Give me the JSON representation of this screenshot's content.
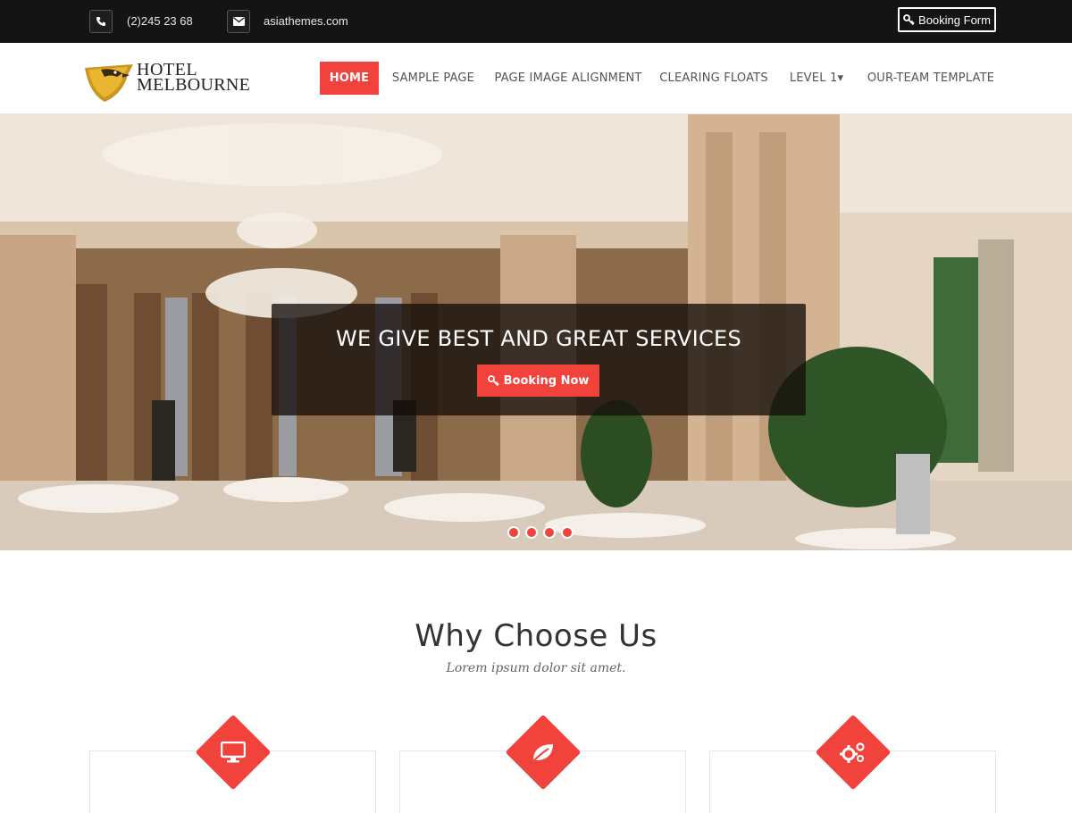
{
  "topbar": {
    "phone": "(2)245 23 68",
    "email": "asiathemes.com",
    "booking_form_label": "Booking Form"
  },
  "brand": {
    "line1": "HOTEL",
    "line2": "MELBOURNE"
  },
  "nav": {
    "items": [
      {
        "label": "HOME",
        "active": true
      },
      {
        "label": "SAMPLE PAGE",
        "active": false
      },
      {
        "label": "PAGE IMAGE ALIGNMENT",
        "active": false
      },
      {
        "label": "CLEARING FLOATS",
        "active": false
      },
      {
        "label": "LEVEL 1▾",
        "active": false
      },
      {
        "label": "OUR-TEAM TEMPLATE",
        "active": false
      }
    ]
  },
  "hero": {
    "title": "WE GIVE BEST AND GREAT SERVICES",
    "button_label": "Booking Now",
    "slides_count": 4,
    "active_slide": 2
  },
  "why": {
    "title": "Why Choose Us",
    "subtitle": "Lorem ipsum dolor sit amet.",
    "features": [
      {
        "icon": "monitor-icon"
      },
      {
        "icon": "leaf-icon"
      },
      {
        "icon": "gears-icon"
      }
    ]
  },
  "colors": {
    "accent": "#f1423b",
    "topbar_bg": "#141414"
  }
}
